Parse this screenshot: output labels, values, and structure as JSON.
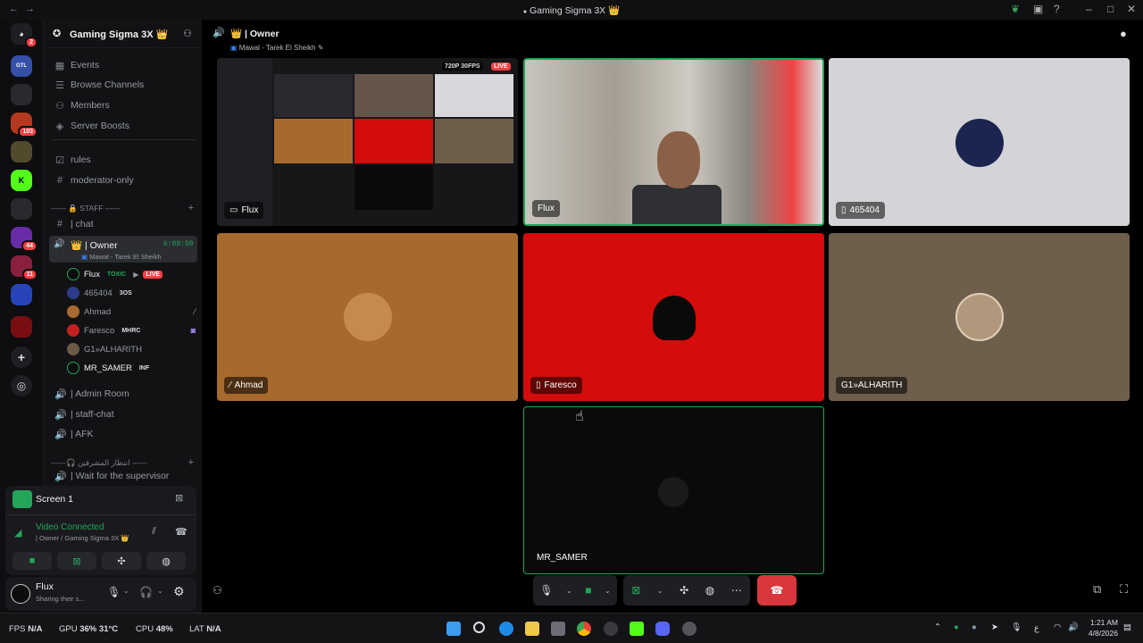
{
  "window": {
    "title": "Gaming Sigma 3X",
    "title_emoji": "👑"
  },
  "server": {
    "name": "Gaming Sigma 3X",
    "crown": "👑"
  },
  "rail_badges": {
    "top": "2",
    "s103": "103",
    "s44": "44",
    "s11": "11"
  },
  "rail_labels": {
    "gtl": "GTL"
  },
  "sidebar": {
    "nav": [
      "Events",
      "Browse Channels",
      "Members",
      "Server Boosts"
    ],
    "channels": [
      {
        "name": "rules",
        "icon": "rules-icon"
      },
      {
        "name": "moderator-only",
        "icon": "hash-icon"
      }
    ],
    "staff_category": "------ 🔒 STAFF ------",
    "chat_channel": "| chat",
    "voice_owner": {
      "name": "| Owner",
      "timer": "6:09:50",
      "status": "Mawal - Tarek El Sheikh"
    },
    "voice_users": [
      {
        "name": "Flux",
        "tag": "TOXIC",
        "live": "LIVE",
        "color": "#1f7a4a"
      },
      {
        "name": "465404",
        "tag": "3OS",
        "color": "#2b3a8a"
      },
      {
        "name": "Ahmad",
        "tag": "",
        "color": "#a86a2e"
      },
      {
        "name": "Faresco",
        "tag": "MHRC",
        "color": "#c22020"
      },
      {
        "name": "G1»ALHARITH",
        "tag": "",
        "color": "#6b5a46"
      },
      {
        "name": "MR_SAMER",
        "tag": "INF",
        "color": "#0d0d0d"
      }
    ],
    "other_voice": [
      "| Admin Room",
      "| staff-chat",
      "| AFK"
    ],
    "supervisor_category": "------🎧 انتظار المشرفين ------",
    "supervisor_channel": "| Wait for the supervisor"
  },
  "voice_panel": {
    "screen_label": "Screen 1",
    "status": "Video Connected",
    "location": "| Owner / Gaming Sigma 3X 👑"
  },
  "user_bar": {
    "name": "Flux",
    "status": "Sharing their s..."
  },
  "channel_header": {
    "name": "| Owner",
    "crown": "👑",
    "status": "Mawal - Tarek El Sheikh"
  },
  "tiles": {
    "t1": {
      "name": "Flux",
      "badge_res": "720P 30FPS",
      "badge_live": "LIVE"
    },
    "t2": {
      "name": "Flux"
    },
    "t3": {
      "name": "465404"
    },
    "t4": {
      "name": "Ahmad"
    },
    "t5": {
      "name": "Faresco"
    },
    "t6": {
      "name": "G1»ALHARITH"
    },
    "t7": {
      "name": "MR_SAMER"
    }
  },
  "taskbar": {
    "fps_label": "FPS",
    "fps_value": "N/A",
    "gpu_label": "GPU",
    "gpu_value": "36%",
    "gpu_temp": "31°C",
    "cpu_label": "CPU",
    "cpu_value": "48%",
    "lat_label": "LAT",
    "lat_value": "N/A",
    "time": "1:21 AM",
    "date": "4/8/2026",
    "lang": "ع"
  },
  "colors": {
    "accent_green": "#23a55a",
    "hangup_red": "#da373c",
    "live_red": "#f23f43"
  }
}
